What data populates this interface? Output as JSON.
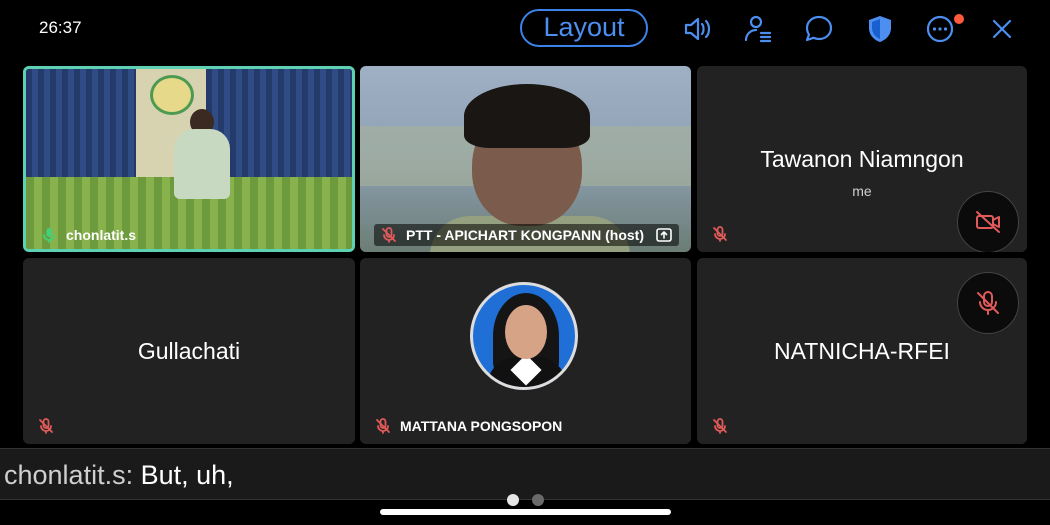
{
  "status": {
    "time": "26:37"
  },
  "toolbar": {
    "layout_label": "Layout",
    "icons": [
      "speaker-icon",
      "participants-icon",
      "chat-icon",
      "security-shield-icon",
      "more-icon",
      "close-icon"
    ],
    "notification_dot_color": "#ff5a3c",
    "accent_color": "#3d82e6"
  },
  "tiles": [
    {
      "name": "chonlatit.s",
      "mic": "on",
      "video": "on",
      "active": true
    },
    {
      "name": "PTT - APICHART KONGPANN (host)",
      "mic": "muted",
      "video": "on",
      "share_icon": "share-up-icon"
    },
    {
      "name": "Tawanon Niamngon",
      "subtitle": "me",
      "mic": "muted",
      "video": "off"
    },
    {
      "name": "Gullachati",
      "mic": "muted",
      "video": "off"
    },
    {
      "name": "MATTANA PONGSOPON",
      "mic": "muted",
      "video": "off",
      "avatar": true
    },
    {
      "name": "NATNICHA-RFEI",
      "mic": "muted",
      "video": "off"
    }
  ],
  "controls": {
    "video_toggle_icon": "video-off-icon",
    "mic_toggle_icon": "mic-off-icon"
  },
  "caption": {
    "speaker": "chonlatit.s:",
    "text": " But, uh,"
  },
  "pager": {
    "pages": 2,
    "current": 1
  }
}
